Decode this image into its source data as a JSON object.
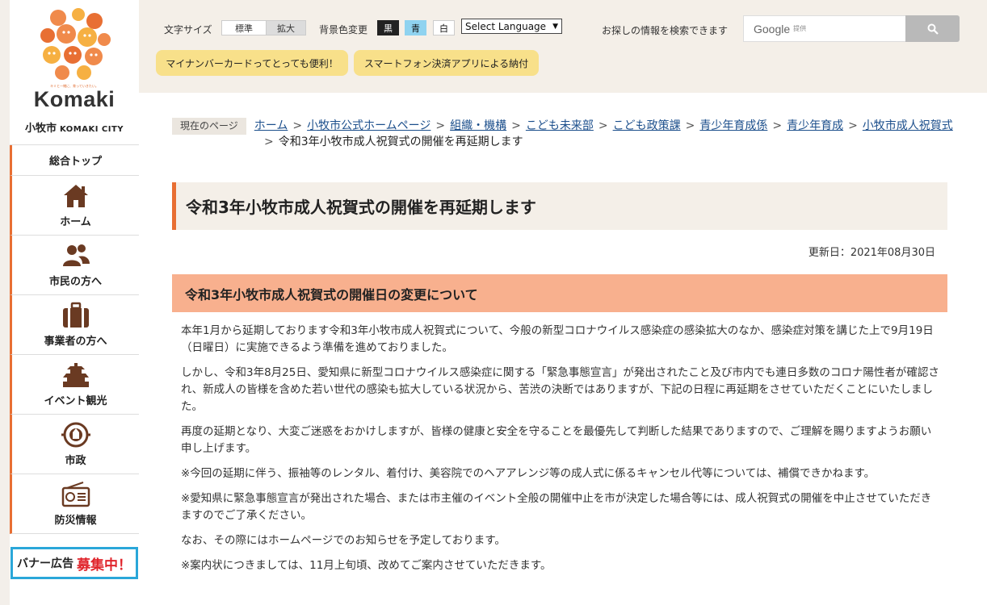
{
  "logo": {
    "word": "Komaki",
    "tagline": "キミと一緒に、育っていきたい。",
    "city_jp": "小牧市",
    "city_en": "KOMAKI CITY"
  },
  "nav": {
    "top_label": "総合トップ",
    "items": [
      {
        "label": "ホーム",
        "icon": "home-icon"
      },
      {
        "label": "市民の方へ",
        "icon": "people-icon"
      },
      {
        "label": "事業者の方へ",
        "icon": "briefcase-icon"
      },
      {
        "label": "イベント観光",
        "icon": "castle-icon"
      },
      {
        "label": "市政",
        "icon": "city-emblem-icon"
      },
      {
        "label": "防災情報",
        "icon": "radio-icon"
      }
    ]
  },
  "banner": {
    "part1": "バナー広告",
    "part2": "募集中！"
  },
  "header": {
    "font_size_label": "文字サイズ",
    "size_standard": "標準",
    "size_large": "拡大",
    "bg_color_label": "背景色変更",
    "color_black": "黒",
    "color_blue": "青",
    "color_white": "白",
    "language_select": "Select Language",
    "search_label": "お探しの情報を検索できます",
    "search_brand": "Google",
    "search_powered": "提供",
    "pill1": "マイナンバーカードってとっても便利！",
    "pill2": "スマートフォン決済アプリによる納付"
  },
  "breadcrumb": {
    "here_label": "現在のページ",
    "links": [
      "ホーム",
      "小牧市公式ホームページ",
      "組織・機構",
      "こども未来部",
      "こども政策課",
      "青少年育成係",
      "青少年育成",
      "小牧市成人祝賀式"
    ],
    "current": "令和3年小牧市成人祝賀式の開催を再延期します"
  },
  "article": {
    "title": "令和3年小牧市成人祝賀式の開催を再延期します",
    "updated": "更新日：2021年08月30日",
    "subheading": "令和3年小牧市成人祝賀式の開催日の変更について",
    "paragraphs": [
      "本年1月から延期しております令和3年小牧市成人祝賀式について、今般の新型コロナウイルス感染症の感染拡大のなか、感染症対策を講じた上で9月19日（日曜日）に実施できるよう準備を進めておりました。",
      "しかし、令和3年8月25日、愛知県に新型コロナウイルス感染症に関する「緊急事態宣言」が発出されたこと及び市内でも連日多数のコロナ陽性者が確認され、新成人の皆様を含めた若い世代の感染も拡大している状況から、苦渋の決断ではありますが、下記の日程に再延期をさせていただくことにいたしました。",
      "再度の延期となり、大変ご迷惑をおかけしますが、皆様の健康と安全を守ることを最優先して判断した結果でありますので、ご理解を賜りますようお願い申し上げます。",
      "※今回の延期に伴う、振袖等のレンタル、着付け、美容院でのヘアアレンジ等の成人式に係るキャンセル代等については、補償できかねます。",
      "※愛知県に緊急事態宣言が発出された場合、または市主催のイベント全般の開催中止を市が決定した場合等には、成人祝賀式の開催を中止させていただきますのでご了承ください。",
      "なお、その際にはホームページでのお知らせを予定しております。",
      "※案内状につきましては、11月上旬頃、改めてご案内させていただきます。"
    ]
  },
  "colors": {
    "accent": "#e86f33",
    "subhead_bg": "#f8b08e",
    "header_bg": "#f4efe8",
    "link": "#1c4f8c",
    "pill_bg": "#f8e08a"
  }
}
